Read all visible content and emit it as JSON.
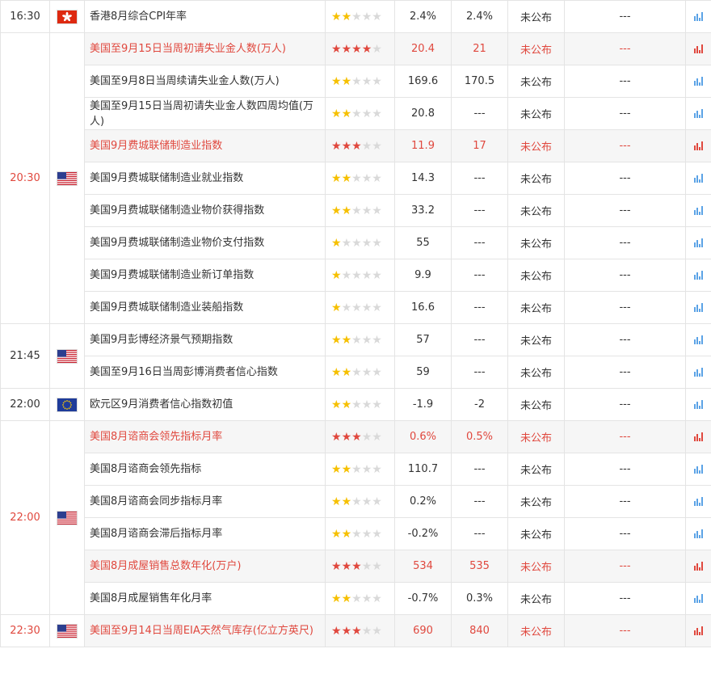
{
  "colors": {
    "accent_red": "#e0483e",
    "star_yellow": "#f6c000",
    "chart_blue": "#5ba3e6"
  },
  "icons": {
    "flag_hk": "hong-kong-flag-icon",
    "flag_us": "us-flag-icon",
    "flag_eu": "eu-flag-icon",
    "chart": "bar-chart-icon"
  },
  "groups": [
    {
      "time": "16:30",
      "flag": "hk",
      "rows": [
        {
          "name": "香港8月综合CPI年率",
          "stars": 2,
          "prev": "2.4%",
          "forecast": "2.4%",
          "actual": "未公布",
          "impact": "---",
          "highlight": false
        }
      ]
    },
    {
      "time": "20:30",
      "flag": "us",
      "rows": [
        {
          "name": "美国至9月15日当周初请失业金人数(万人)",
          "stars": 4,
          "prev": "20.4",
          "forecast": "21",
          "actual": "未公布",
          "impact": "---",
          "highlight": true
        },
        {
          "name": "美国至9月8日当周续请失业金人数(万人)",
          "stars": 2,
          "prev": "169.6",
          "forecast": "170.5",
          "actual": "未公布",
          "impact": "---",
          "highlight": false
        },
        {
          "name": "美国至9月15日当周初请失业金人数四周均值(万人)",
          "stars": 2,
          "prev": "20.8",
          "forecast": "---",
          "actual": "未公布",
          "impact": "---",
          "highlight": false
        },
        {
          "name": "美国9月费城联储制造业指数",
          "stars": 3,
          "prev": "11.9",
          "forecast": "17",
          "actual": "未公布",
          "impact": "---",
          "highlight": true
        },
        {
          "name": "美国9月费城联储制造业就业指数",
          "stars": 2,
          "prev": "14.3",
          "forecast": "---",
          "actual": "未公布",
          "impact": "---",
          "highlight": false
        },
        {
          "name": "美国9月费城联储制造业物价获得指数",
          "stars": 2,
          "prev": "33.2",
          "forecast": "---",
          "actual": "未公布",
          "impact": "---",
          "highlight": false
        },
        {
          "name": "美国9月费城联储制造业物价支付指数",
          "stars": 1,
          "prev": "55",
          "forecast": "---",
          "actual": "未公布",
          "impact": "---",
          "highlight": false
        },
        {
          "name": "美国9月费城联储制造业新订单指数",
          "stars": 1,
          "prev": "9.9",
          "forecast": "---",
          "actual": "未公布",
          "impact": "---",
          "highlight": false
        },
        {
          "name": "美国9月费城联储制造业装船指数",
          "stars": 1,
          "prev": "16.6",
          "forecast": "---",
          "actual": "未公布",
          "impact": "---",
          "highlight": false
        }
      ]
    },
    {
      "time": "21:45",
      "flag": "us",
      "rows": [
        {
          "name": "美国9月彭博经济景气预期指数",
          "stars": 2,
          "prev": "57",
          "forecast": "---",
          "actual": "未公布",
          "impact": "---",
          "highlight": false
        },
        {
          "name": "美国至9月16日当周彭博消费者信心指数",
          "stars": 2,
          "prev": "59",
          "forecast": "---",
          "actual": "未公布",
          "impact": "---",
          "highlight": false
        }
      ]
    },
    {
      "time": "22:00",
      "flag": "eu",
      "rows": [
        {
          "name": "欧元区9月消费者信心指数初值",
          "stars": 2,
          "prev": "-1.9",
          "forecast": "-2",
          "actual": "未公布",
          "impact": "---",
          "highlight": false
        }
      ]
    },
    {
      "time": "22:00",
      "flag": "us",
      "rows": [
        {
          "name": "美国8月谘商会领先指标月率",
          "stars": 3,
          "prev": "0.6%",
          "forecast": "0.5%",
          "actual": "未公布",
          "impact": "---",
          "highlight": true
        },
        {
          "name": "美国8月谘商会领先指标",
          "stars": 2,
          "prev": "110.7",
          "forecast": "---",
          "actual": "未公布",
          "impact": "---",
          "highlight": false
        },
        {
          "name": "美国8月谘商会同步指标月率",
          "stars": 2,
          "prev": "0.2%",
          "forecast": "---",
          "actual": "未公布",
          "impact": "---",
          "highlight": false
        },
        {
          "name": "美国8月谘商会滞后指标月率",
          "stars": 2,
          "prev": "-0.2%",
          "forecast": "---",
          "actual": "未公布",
          "impact": "---",
          "highlight": false
        },
        {
          "name": "美国8月成屋销售总数年化(万户)",
          "stars": 3,
          "prev": "534",
          "forecast": "535",
          "actual": "未公布",
          "impact": "---",
          "highlight": true
        },
        {
          "name": "美国8月成屋销售年化月率",
          "stars": 2,
          "prev": "-0.7%",
          "forecast": "0.3%",
          "actual": "未公布",
          "impact": "---",
          "highlight": false
        }
      ]
    },
    {
      "time": "22:30",
      "flag": "us",
      "rows": [
        {
          "name": "美国至9月14日当周EIA天然气库存(亿立方英尺)",
          "stars": 3,
          "prev": "690",
          "forecast": "840",
          "actual": "未公布",
          "impact": "---",
          "highlight": true
        }
      ]
    }
  ]
}
